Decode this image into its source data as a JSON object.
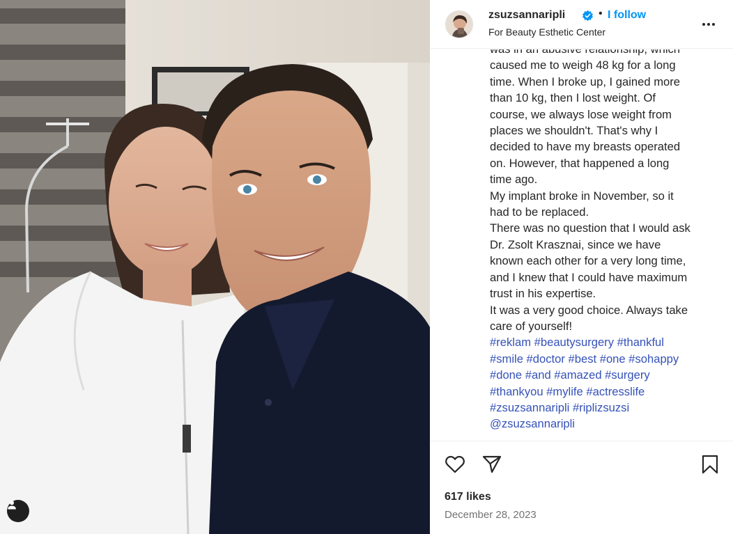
{
  "post": {
    "username": "zsuzsannaripli",
    "separator": "•",
    "follow_label": "I follow",
    "location": "For Beauty Esthetic Center",
    "caption_partial_top": "was in an abusive relationship, which",
    "caption_lines": [
      "caused me to weigh 48 kg for a long",
      "time. When I broke up, I gained more",
      "than 10 kg, then I lost weight. Of",
      "course, we always lose weight from",
      "places we shouldn't. That's why I",
      "decided to have my breasts operated",
      "on. However, that happened a long",
      "time ago.",
      "My implant broke in November, so it",
      "had to be replaced.",
      "There was no question that I would ask",
      "Dr. Zsolt Krasznai, since we have",
      "known each other for a very long time,",
      "and I knew that I could have maximum",
      "trust in his expertise.",
      "It was a very good choice. Always take",
      "care of yourself!"
    ],
    "hashtag_lines": [
      "#reklam #beautysurgery #thankful",
      "#smile #doctor #best #one #sohappy",
      "#done #and #amazed #surgery",
      "#thankyou #mylife #actresslife",
      "#zsuzsannaripli #riplizsuzsi",
      "@zsuzsannaripli"
    ],
    "likes": "617 likes",
    "date": "December 28, 2023"
  },
  "icons": {
    "verified": "verified-badge-icon",
    "more": "more-options-icon",
    "like": "heart-icon",
    "share": "send-icon",
    "save": "bookmark-icon",
    "tags": "user-tag-icon"
  },
  "colors": {
    "link": "#0095f6",
    "hashtag": "#3552b8",
    "text": "#262626",
    "muted": "#737373"
  }
}
